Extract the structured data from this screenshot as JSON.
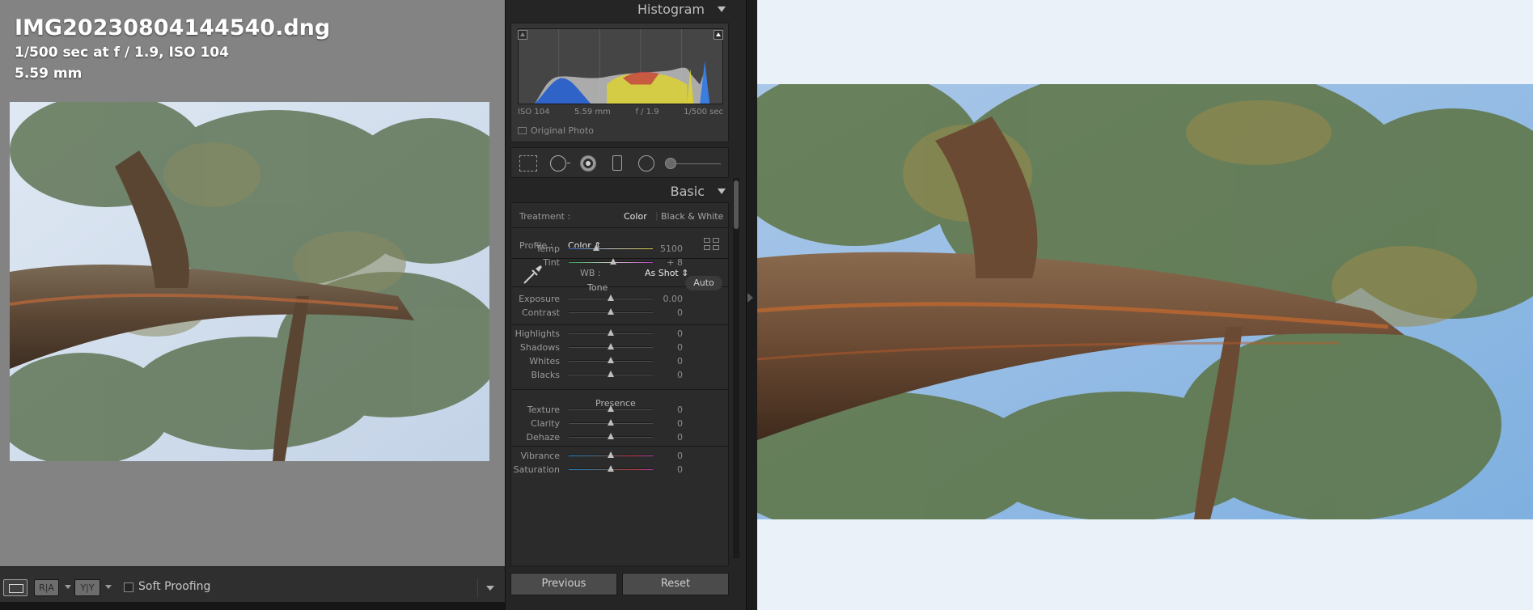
{
  "photo": {
    "filename": "IMG20230804144540.dng",
    "exposure": "1/500 sec at f / 1.9, ISO 104",
    "focal_length": "5.59 mm"
  },
  "toolbar": {
    "loupe_view": "loupe-view-icon",
    "before_after_ra_label": "R|A",
    "before_after_yy_label": "Y|Y",
    "soft_proofing_label": "Soft Proofing",
    "soft_proofing_checked": false
  },
  "histogram": {
    "title": "Histogram",
    "iso": "ISO 104",
    "focal": "5.59 mm",
    "aperture": "f / 1.9",
    "shutter": "1/500 sec",
    "original_photo_label": "Original Photo"
  },
  "basic": {
    "title": "Basic",
    "treatment_label": "Treatment :",
    "treatment_color": "Color",
    "treatment_bw": "Black & White",
    "profile_label": "Profile :",
    "profile_value": "Color",
    "wb_label": "WB :",
    "wb_value": "As Shot",
    "tone_label": "Tone",
    "auto_label": "Auto",
    "presence_label": "Presence",
    "sliders": [
      {
        "name": "Temp",
        "value": "5100",
        "position": 0.33
      },
      {
        "name": "Tint",
        "value": "+ 8",
        "position": 0.53
      },
      {
        "name": "Exposure",
        "value": "0.00",
        "position": 0.5
      },
      {
        "name": "Contrast",
        "value": "0",
        "position": 0.5
      },
      {
        "name": "Highlights",
        "value": "0",
        "position": 0.5
      },
      {
        "name": "Shadows",
        "value": "0",
        "position": 0.5
      },
      {
        "name": "Whites",
        "value": "0",
        "position": 0.5
      },
      {
        "name": "Blacks",
        "value": "0",
        "position": 0.5
      },
      {
        "name": "Texture",
        "value": "0",
        "position": 0.5
      },
      {
        "name": "Clarity",
        "value": "0",
        "position": 0.5
      },
      {
        "name": "Dehaze",
        "value": "0",
        "position": 0.5
      },
      {
        "name": "Vibrance",
        "value": "0",
        "position": 0.5
      },
      {
        "name": "Saturation",
        "value": "0",
        "position": 0.5
      }
    ]
  },
  "buttons": {
    "previous": "Previous",
    "reset": "Reset"
  },
  "colors": {
    "left_bg": "#838383",
    "panel_bg": "#252525",
    "preview_bg": "#eaf1f8",
    "accent_text": "#e8e8e8"
  }
}
